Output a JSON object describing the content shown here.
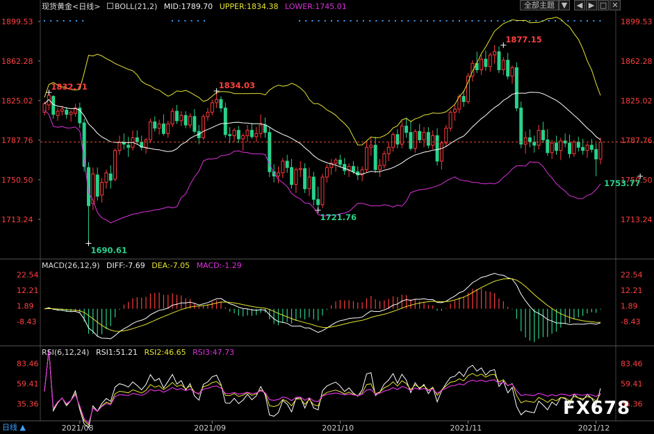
{
  "header": {
    "instrument": "现货黄金",
    "period": "<日线>",
    "indicator_label": "BOLL(21,2)",
    "mid": "MID:1789.70",
    "upper": "UPPER:1834.38",
    "lower": "LOWER:1745.01"
  },
  "toolbar": {
    "theme_select": "全部主题",
    "buttons": [
      "▼",
      "◀",
      "▶",
      "□",
      "✕"
    ]
  },
  "macd_header": {
    "label": "MACD(26,12,9)",
    "diff": "DIFF:-7.69",
    "dea": "DEA:-7.05",
    "macd": "MACD:-1.29"
  },
  "rsi_header": {
    "label": "RSI(6,12,24)",
    "rsi1": "RSI1:51.21",
    "rsi2": "RSI2:46.65",
    "rsi3": "RSI3:47.73"
  },
  "bottom": {
    "label": "日线 ▲"
  },
  "watermark": "FX678",
  "colors": {
    "up": "#ff3c3c",
    "down": "#28d28c",
    "mid": "#ffffff",
    "upper": "#e6e632",
    "lower": "#dc32dc",
    "axis_text": "#ff4040",
    "grid": "#444444"
  },
  "chart_data": {
    "type": "candlestick",
    "y_ticks": [
      "1899.53",
      "1862.28",
      "1825.02",
      "1787.76",
      "1750.50",
      "1713.24"
    ],
    "ylim": [
      1676.5,
      1904
    ],
    "x_labels": [
      "2021/08",
      "2021/09",
      "2021/10",
      "2021/11",
      "2021/12"
    ],
    "annotations": [
      {
        "text": "1832.71",
        "index": 1,
        "price": 1832.71,
        "kind": "high"
      },
      {
        "text": "1690.61",
        "index": 10,
        "price": 1690.61,
        "kind": "low"
      },
      {
        "text": "1834.03",
        "index": 39,
        "price": 1834.03,
        "kind": "high"
      },
      {
        "text": "1721.76",
        "index": 62,
        "price": 1721.76,
        "kind": "low"
      },
      {
        "text": "1877.15",
        "index": 104,
        "price": 1877.15,
        "kind": "high"
      },
      {
        "text": "1753.77",
        "index": 135,
        "price": 1753.77,
        "kind": "low"
      }
    ],
    "candles": [
      [
        1814,
        1824,
        1811,
        1822
      ],
      [
        1821,
        1832.7,
        1816,
        1830
      ],
      [
        1829,
        1830,
        1808,
        1812
      ],
      [
        1811,
        1818,
        1806,
        1815
      ],
      [
        1815,
        1820,
        1811,
        1817
      ],
      [
        1816,
        1819,
        1808,
        1812
      ],
      [
        1812,
        1816,
        1805,
        1814
      ],
      [
        1813,
        1822,
        1810,
        1818
      ],
      [
        1818,
        1823,
        1799,
        1804
      ],
      [
        1804,
        1808,
        1758,
        1763
      ],
      [
        1762,
        1767,
        1690.6,
        1726
      ],
      [
        1728,
        1762,
        1722,
        1756
      ],
      [
        1755,
        1762,
        1731,
        1735
      ],
      [
        1736,
        1752,
        1729,
        1748
      ],
      [
        1748,
        1760,
        1742,
        1757
      ],
      [
        1756,
        1764,
        1742,
        1750
      ],
      [
        1751,
        1780,
        1749,
        1778
      ],
      [
        1778,
        1792,
        1774,
        1786
      ],
      [
        1786,
        1794,
        1779,
        1784
      ],
      [
        1783,
        1791,
        1772,
        1781
      ],
      [
        1781,
        1797,
        1778,
        1790
      ],
      [
        1790,
        1797,
        1784,
        1786
      ],
      [
        1786,
        1792,
        1778,
        1781
      ],
      [
        1781,
        1790,
        1775,
        1788
      ],
      [
        1788,
        1808,
        1785,
        1805
      ],
      [
        1805,
        1810,
        1796,
        1799
      ],
      [
        1799,
        1807,
        1793,
        1803
      ],
      [
        1803,
        1812,
        1792,
        1794
      ],
      [
        1794,
        1806,
        1790,
        1803
      ],
      [
        1803,
        1818,
        1800,
        1815
      ],
      [
        1815,
        1821,
        1803,
        1806
      ],
      [
        1806,
        1815,
        1801,
        1811
      ],
      [
        1811,
        1815,
        1799,
        1802
      ],
      [
        1802,
        1813,
        1799,
        1810
      ],
      [
        1810,
        1817,
        1794,
        1796
      ],
      [
        1796,
        1802,
        1784,
        1790
      ],
      [
        1790,
        1812,
        1788,
        1810
      ],
      [
        1810,
        1818,
        1806,
        1814
      ],
      [
        1814,
        1826,
        1811,
        1823
      ],
      [
        1823,
        1834,
        1818,
        1826
      ],
      [
        1826,
        1829,
        1814,
        1818
      ],
      [
        1818,
        1823,
        1790,
        1793
      ],
      [
        1793,
        1800,
        1785,
        1792
      ],
      [
        1792,
        1799,
        1786,
        1797
      ],
      [
        1797,
        1801,
        1785,
        1789
      ],
      [
        1789,
        1794,
        1778,
        1792
      ],
      [
        1792,
        1802,
        1786,
        1797
      ],
      [
        1797,
        1804,
        1789,
        1791
      ],
      [
        1791,
        1800,
        1786,
        1794
      ],
      [
        1794,
        1812,
        1790,
        1802
      ],
      [
        1802,
        1809,
        1790,
        1795
      ],
      [
        1795,
        1800,
        1753,
        1758
      ],
      [
        1758,
        1765,
        1748,
        1754
      ],
      [
        1754,
        1763,
        1747,
        1757
      ],
      [
        1757,
        1771,
        1752,
        1768
      ],
      [
        1768,
        1774,
        1757,
        1762
      ],
      [
        1762,
        1770,
        1742,
        1746
      ],
      [
        1746,
        1762,
        1738,
        1760
      ],
      [
        1760,
        1768,
        1753,
        1761
      ],
      [
        1761,
        1766,
        1738,
        1742
      ],
      [
        1742,
        1762,
        1735,
        1753
      ],
      [
        1753,
        1758,
        1726,
        1732
      ],
      [
        1732,
        1744,
        1721.8,
        1727
      ],
      [
        1727,
        1756,
        1724,
        1753
      ],
      [
        1753,
        1765,
        1748,
        1762
      ],
      [
        1762,
        1770,
        1755,
        1766
      ],
      [
        1766,
        1771,
        1758,
        1769
      ],
      [
        1769,
        1774,
        1762,
        1765
      ],
      [
        1765,
        1771,
        1755,
        1759
      ],
      [
        1759,
        1766,
        1753,
        1763
      ],
      [
        1763,
        1768,
        1756,
        1758
      ],
      [
        1758,
        1763,
        1750,
        1755
      ],
      [
        1755,
        1763,
        1749,
        1760
      ],
      [
        1760,
        1786,
        1757,
        1781
      ],
      [
        1781,
        1790,
        1773,
        1783
      ],
      [
        1783,
        1791,
        1757,
        1760
      ],
      [
        1760,
        1770,
        1753,
        1764
      ],
      [
        1764,
        1778,
        1761,
        1775
      ],
      [
        1775,
        1786,
        1768,
        1781
      ],
      [
        1781,
        1795,
        1777,
        1793
      ],
      [
        1793,
        1798,
        1780,
        1784
      ],
      [
        1784,
        1806,
        1780,
        1801
      ],
      [
        1801,
        1809,
        1790,
        1795
      ],
      [
        1795,
        1806,
        1778,
        1780
      ],
      [
        1780,
        1798,
        1776,
        1796
      ],
      [
        1796,
        1803,
        1785,
        1788
      ],
      [
        1788,
        1800,
        1781,
        1795
      ],
      [
        1795,
        1800,
        1780,
        1783
      ],
      [
        1783,
        1797,
        1779,
        1792
      ],
      [
        1792,
        1799,
        1764,
        1768
      ],
      [
        1768,
        1787,
        1760,
        1785
      ],
      [
        1785,
        1802,
        1781,
        1799
      ],
      [
        1799,
        1816,
        1796,
        1814
      ],
      [
        1814,
        1821,
        1806,
        1817
      ],
      [
        1817,
        1831,
        1813,
        1829
      ],
      [
        1829,
        1834,
        1819,
        1824
      ],
      [
        1824,
        1851,
        1822,
        1848
      ],
      [
        1848,
        1863,
        1843,
        1860
      ],
      [
        1860,
        1871,
        1851,
        1854
      ],
      [
        1854,
        1868,
        1849,
        1864
      ],
      [
        1864,
        1872,
        1853,
        1857
      ],
      [
        1857,
        1870,
        1852,
        1868
      ],
      [
        1868,
        1877.2,
        1860,
        1871
      ],
      [
        1871,
        1876,
        1851,
        1854
      ],
      [
        1854,
        1866,
        1849,
        1863
      ],
      [
        1863,
        1870,
        1845,
        1848
      ],
      [
        1848,
        1858,
        1841,
        1856
      ],
      [
        1856,
        1861,
        1815,
        1818
      ],
      [
        1818,
        1824,
        1780,
        1784
      ],
      [
        1784,
        1796,
        1775,
        1790
      ],
      [
        1790,
        1798,
        1781,
        1786
      ],
      [
        1786,
        1792,
        1776,
        1783
      ],
      [
        1783,
        1802,
        1779,
        1797
      ],
      [
        1797,
        1805,
        1785,
        1788
      ],
      [
        1788,
        1798,
        1773,
        1776
      ],
      [
        1776,
        1788,
        1770,
        1785
      ],
      [
        1785,
        1792,
        1774,
        1778
      ],
      [
        1778,
        1790,
        1769,
        1787
      ],
      [
        1787,
        1794,
        1781,
        1785
      ],
      [
        1785,
        1793,
        1771,
        1775
      ],
      [
        1775,
        1788,
        1772,
        1786
      ],
      [
        1786,
        1791,
        1777,
        1781
      ],
      [
        1781,
        1789,
        1774,
        1778
      ],
      [
        1778,
        1785,
        1771,
        1783
      ],
      [
        1783,
        1789,
        1776,
        1779
      ],
      [
        1779,
        1785,
        1753.8,
        1770
      ],
      [
        1770,
        1790,
        1765,
        1786
      ]
    ],
    "series": []
  }
}
